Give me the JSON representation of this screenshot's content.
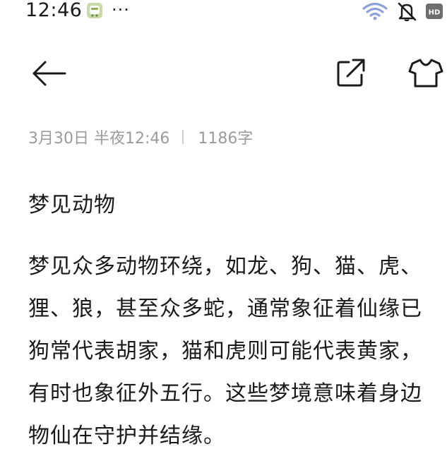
{
  "status_bar": {
    "time": "12:46",
    "more": "···",
    "icons": [
      "app-notification-icon",
      "wifi-icon",
      "mute-icon",
      "hd-icon"
    ],
    "hd_label": "HD"
  },
  "toolbar": {
    "back_icon": "back-arrow-icon",
    "share_icon": "share-icon",
    "theme_icon": "tshirt-icon"
  },
  "note": {
    "date": "3月30日 半夜12:46",
    "word_count": "1186字",
    "title": "梦见动物",
    "body_lines": [
      "梦见众多动物环绕，如龙、狗、猫、虎、",
      "狸、狼，甚至众多蛇，通常象征着仙缘已",
      "狗常代表胡家，猫和虎则可能代表黄家，",
      "有时也象征外五行。这些梦境意味着身边",
      "物仙在守护并结缘。"
    ]
  }
}
